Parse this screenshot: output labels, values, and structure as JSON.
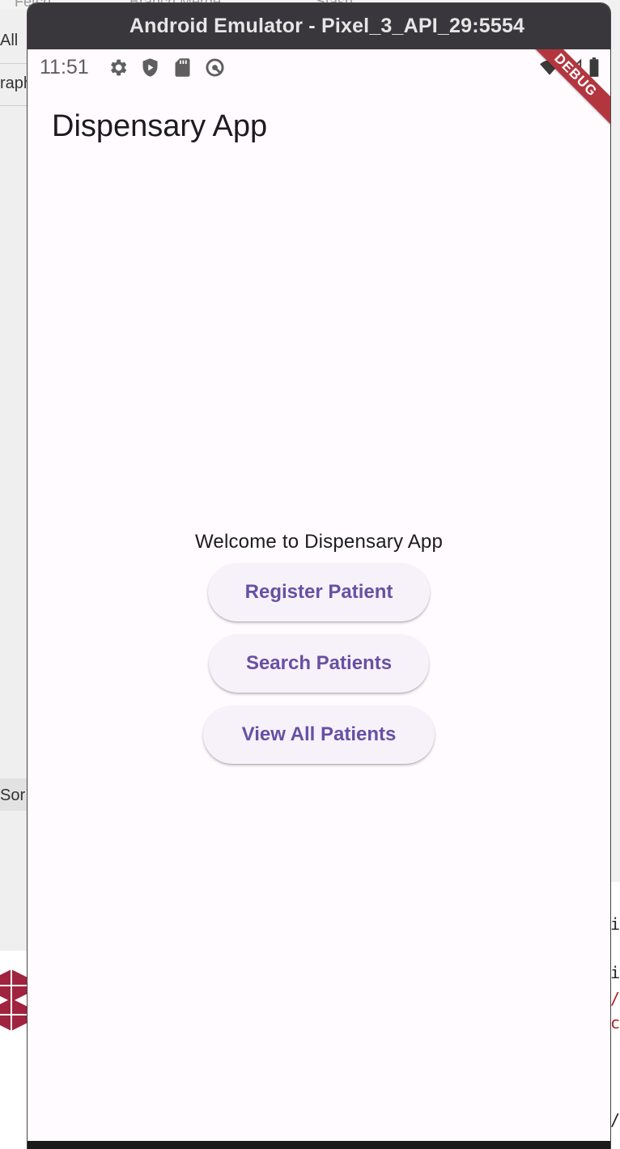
{
  "background": {
    "top_fragments": [
      "Fetch",
      "Branch  Merge",
      "Stash"
    ],
    "left_fragments": [
      "All",
      "raph",
      "Sor"
    ],
    "right_code_fragments": [
      "i",
      "i",
      "/",
      "c",
      "/"
    ]
  },
  "emulator": {
    "title": "Android Emulator - Pixel_3_API_29:5554"
  },
  "status_bar": {
    "time": "11:51",
    "icons": [
      "gear-icon",
      "shield-play-icon",
      "sd-card-icon",
      "sync-icon"
    ],
    "right_icons": [
      "wifi-icon",
      "signal-icon",
      "battery-icon"
    ]
  },
  "debug_banner": {
    "label": "DEBUG",
    "color": "#b3363f"
  },
  "app": {
    "title": "Dispensary App",
    "welcome_text": "Welcome to Dispensary App",
    "buttons": {
      "register": "Register Patient",
      "search": "Search Patients",
      "view_all": "View All Patients"
    }
  },
  "colors": {
    "primary": "#6750a4",
    "surface": "#fffbfe",
    "button_surface": "#f7f2fa",
    "titlebar": "#3a373c"
  }
}
